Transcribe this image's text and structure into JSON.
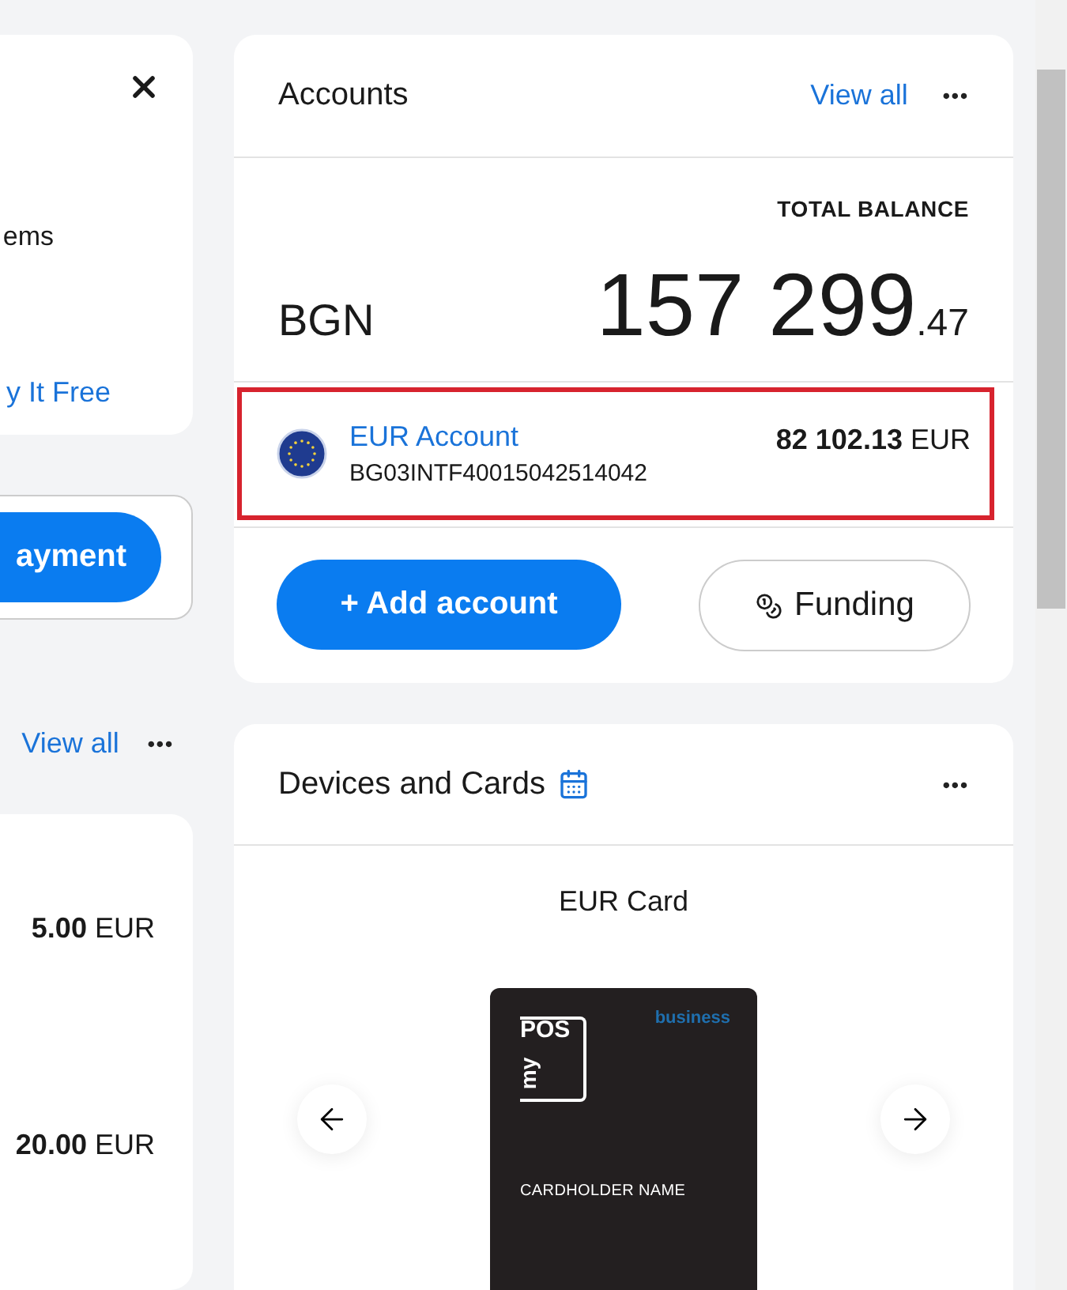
{
  "left_column": {
    "promo": {
      "text": "ems",
      "link": "y It Free"
    },
    "payment_button": "ayment",
    "section": {
      "link": "View all",
      "more": "•••"
    },
    "rows": [
      {
        "amount": "5.00",
        "currency": "EUR"
      },
      {
        "amount": "20.00",
        "currency": "EUR"
      }
    ]
  },
  "accounts": {
    "title": "Accounts",
    "view_all": "View all",
    "more": "•••",
    "total_label": "TOTAL BALANCE",
    "currency": "BGN",
    "total_whole": "157 299",
    "total_fraction": ".47",
    "items": [
      {
        "name": "EUR Account",
        "iban": "BG03INTF40015042514042",
        "amount": "82 102.13",
        "currency": "EUR",
        "highlighted": true
      }
    ],
    "add_button": "+ Add account",
    "funding_button": "Funding"
  },
  "devices": {
    "title": "Devices and Cards",
    "more": "•••",
    "card_title": "EUR Card",
    "card": {
      "brand_top": "POS",
      "brand_side": "my",
      "tier": "business",
      "holder": "CARDHOLDER NAME"
    }
  }
}
